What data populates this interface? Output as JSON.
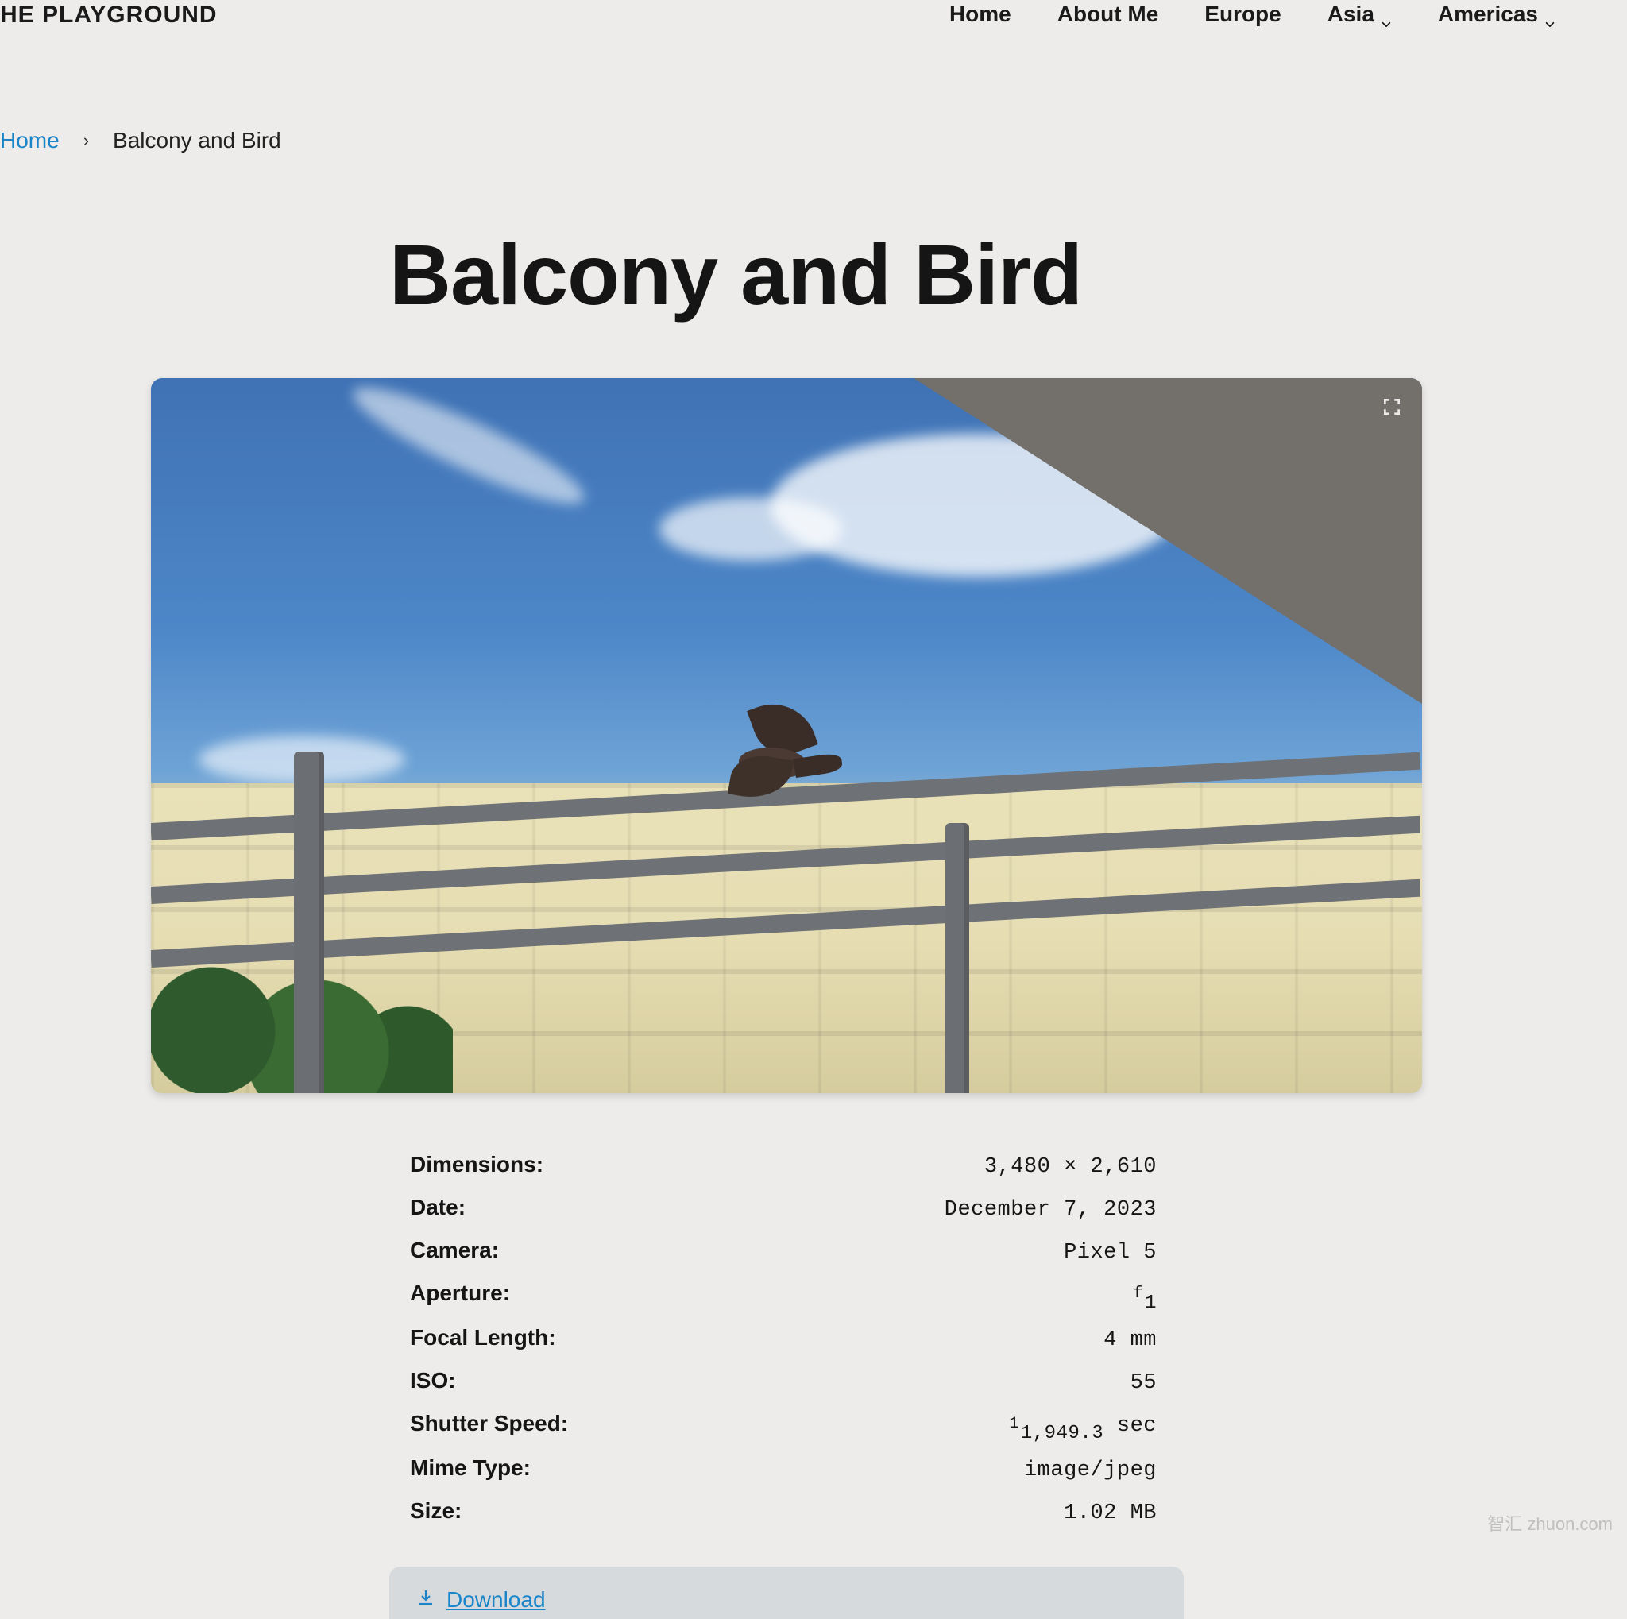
{
  "brand": "HE PLAYGROUND",
  "nav": {
    "home": "Home",
    "about": "About Me",
    "europe": "Europe",
    "asia": "Asia",
    "americas": "Americas"
  },
  "breadcrumb": {
    "home": "Home",
    "sep": "›",
    "current": "Balcony and Bird"
  },
  "title": "Balcony and Bird",
  "meta": {
    "dimensions": {
      "label": "Dimensions:",
      "value": "3,480 × 2,610"
    },
    "date": {
      "label": "Date:",
      "value": "December 7, 2023"
    },
    "camera": {
      "label": "Camera:",
      "value": "Pixel 5"
    },
    "aperture": {
      "label": "Aperture:",
      "num": "f",
      "den": "1"
    },
    "focal": {
      "label": "Focal Length:",
      "value": "4 mm"
    },
    "iso": {
      "label": "ISO:",
      "value": "55"
    },
    "shutter": {
      "label": "Shutter Speed:",
      "num": "1",
      "den": "1,949.3",
      "unit": " sec"
    },
    "mime": {
      "label": "Mime Type:",
      "value": "image/jpeg"
    },
    "size": {
      "label": "Size:",
      "value": "1.02 MB"
    }
  },
  "download": "Download",
  "watermark": "智汇 zhuon.com"
}
